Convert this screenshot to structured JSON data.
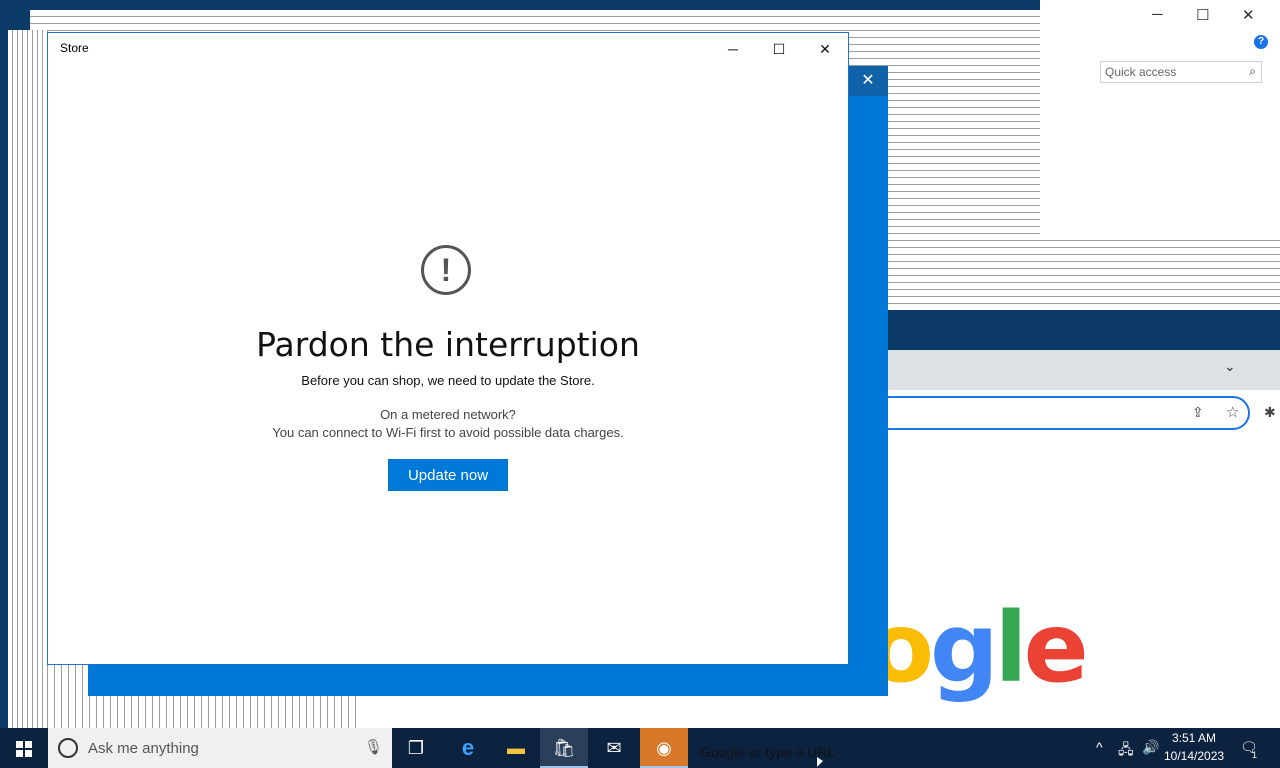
{
  "store_dialog": {
    "title": "Store",
    "minimize_label": "─",
    "maximize_label": "☐",
    "close_label": "✕",
    "alert_glyph": "!",
    "headline": "Pardon the interruption",
    "message": "Before you can shop, we need to update the Store.",
    "metered_question": "On a metered network?",
    "metered_hint": "You can connect to Wi-Fi first to avoid possible data charges.",
    "update_button": "Update now",
    "accent_color": "#0078d7"
  },
  "explorer": {
    "search_placeholder": "Quick access",
    "minimize_label": "─",
    "maximize_label": "☐",
    "close_label": "✕",
    "help_label": "?"
  },
  "chrome": {
    "logo_text": "ogle",
    "omnibox_placeholder": "Google or type a URL"
  },
  "taskbar": {
    "search_placeholder": "Ask me anything",
    "time": "3:51 AM",
    "date": "10/14/2023",
    "notification_count": "1",
    "icons": [
      "windows-start-icon",
      "cortana-icon",
      "microphone-icon",
      "task-view-icon",
      "edge-icon",
      "file-explorer-icon",
      "store-icon",
      "mail-icon",
      "chrome-icon"
    ]
  }
}
